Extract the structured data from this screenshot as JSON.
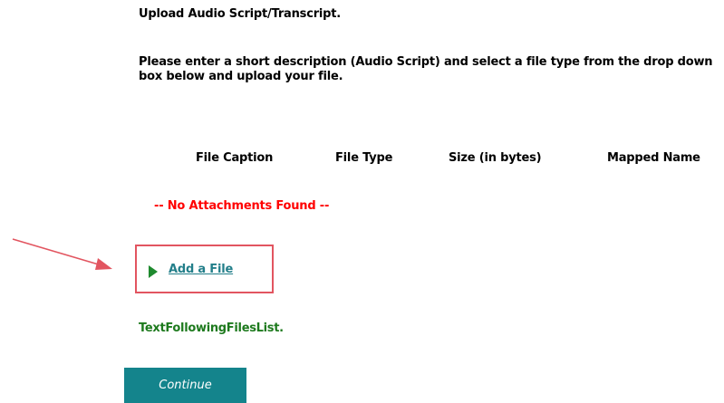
{
  "page": {
    "heading": "Upload Audio Script/Transcript.",
    "instructions": "Please enter a short description (Audio Script) and select a file type from the drop down box below and upload your file."
  },
  "attachments_table": {
    "columns": [
      "File Caption",
      "File Type",
      "Size (in bytes)",
      "Mapped Name"
    ],
    "empty_message": "-- No Attachments Found --"
  },
  "add_file": {
    "label": "Add a File",
    "icon": "play-triangle-icon"
  },
  "footer_text": "TextFollowingFilesList.",
  "continue_button": {
    "label": "Continue"
  },
  "colors": {
    "empty_message": "#ff0000",
    "link": "#237f8a",
    "footer_text": "#1e7a1e",
    "play_icon": "#1e8a2e",
    "button_bg": "#14848c",
    "highlight_box": "#e25560",
    "annotation_arrow": "#e25560"
  }
}
